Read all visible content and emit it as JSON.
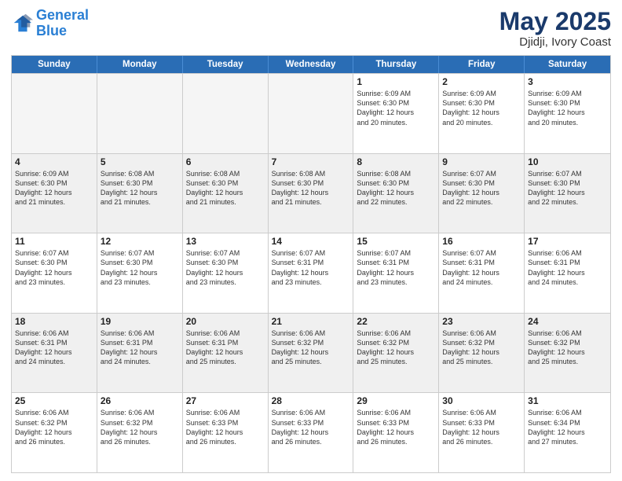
{
  "logo": {
    "line1": "General",
    "line2": "Blue"
  },
  "title": "May 2025",
  "subtitle": "Djidji, Ivory Coast",
  "header": {
    "days": [
      "Sunday",
      "Monday",
      "Tuesday",
      "Wednesday",
      "Thursday",
      "Friday",
      "Saturday"
    ]
  },
  "rows": [
    [
      {
        "day": "",
        "text": "",
        "empty": true
      },
      {
        "day": "",
        "text": "",
        "empty": true
      },
      {
        "day": "",
        "text": "",
        "empty": true
      },
      {
        "day": "",
        "text": "",
        "empty": true
      },
      {
        "day": "1",
        "text": "Sunrise: 6:09 AM\nSunset: 6:30 PM\nDaylight: 12 hours\nand 20 minutes."
      },
      {
        "day": "2",
        "text": "Sunrise: 6:09 AM\nSunset: 6:30 PM\nDaylight: 12 hours\nand 20 minutes."
      },
      {
        "day": "3",
        "text": "Sunrise: 6:09 AM\nSunset: 6:30 PM\nDaylight: 12 hours\nand 20 minutes."
      }
    ],
    [
      {
        "day": "4",
        "text": "Sunrise: 6:09 AM\nSunset: 6:30 PM\nDaylight: 12 hours\nand 21 minutes."
      },
      {
        "day": "5",
        "text": "Sunrise: 6:08 AM\nSunset: 6:30 PM\nDaylight: 12 hours\nand 21 minutes."
      },
      {
        "day": "6",
        "text": "Sunrise: 6:08 AM\nSunset: 6:30 PM\nDaylight: 12 hours\nand 21 minutes."
      },
      {
        "day": "7",
        "text": "Sunrise: 6:08 AM\nSunset: 6:30 PM\nDaylight: 12 hours\nand 21 minutes."
      },
      {
        "day": "8",
        "text": "Sunrise: 6:08 AM\nSunset: 6:30 PM\nDaylight: 12 hours\nand 22 minutes."
      },
      {
        "day": "9",
        "text": "Sunrise: 6:07 AM\nSunset: 6:30 PM\nDaylight: 12 hours\nand 22 minutes."
      },
      {
        "day": "10",
        "text": "Sunrise: 6:07 AM\nSunset: 6:30 PM\nDaylight: 12 hours\nand 22 minutes."
      }
    ],
    [
      {
        "day": "11",
        "text": "Sunrise: 6:07 AM\nSunset: 6:30 PM\nDaylight: 12 hours\nand 23 minutes."
      },
      {
        "day": "12",
        "text": "Sunrise: 6:07 AM\nSunset: 6:30 PM\nDaylight: 12 hours\nand 23 minutes."
      },
      {
        "day": "13",
        "text": "Sunrise: 6:07 AM\nSunset: 6:30 PM\nDaylight: 12 hours\nand 23 minutes."
      },
      {
        "day": "14",
        "text": "Sunrise: 6:07 AM\nSunset: 6:31 PM\nDaylight: 12 hours\nand 23 minutes."
      },
      {
        "day": "15",
        "text": "Sunrise: 6:07 AM\nSunset: 6:31 PM\nDaylight: 12 hours\nand 23 minutes."
      },
      {
        "day": "16",
        "text": "Sunrise: 6:07 AM\nSunset: 6:31 PM\nDaylight: 12 hours\nand 24 minutes."
      },
      {
        "day": "17",
        "text": "Sunrise: 6:06 AM\nSunset: 6:31 PM\nDaylight: 12 hours\nand 24 minutes."
      }
    ],
    [
      {
        "day": "18",
        "text": "Sunrise: 6:06 AM\nSunset: 6:31 PM\nDaylight: 12 hours\nand 24 minutes."
      },
      {
        "day": "19",
        "text": "Sunrise: 6:06 AM\nSunset: 6:31 PM\nDaylight: 12 hours\nand 24 minutes."
      },
      {
        "day": "20",
        "text": "Sunrise: 6:06 AM\nSunset: 6:31 PM\nDaylight: 12 hours\nand 25 minutes."
      },
      {
        "day": "21",
        "text": "Sunrise: 6:06 AM\nSunset: 6:32 PM\nDaylight: 12 hours\nand 25 minutes."
      },
      {
        "day": "22",
        "text": "Sunrise: 6:06 AM\nSunset: 6:32 PM\nDaylight: 12 hours\nand 25 minutes."
      },
      {
        "day": "23",
        "text": "Sunrise: 6:06 AM\nSunset: 6:32 PM\nDaylight: 12 hours\nand 25 minutes."
      },
      {
        "day": "24",
        "text": "Sunrise: 6:06 AM\nSunset: 6:32 PM\nDaylight: 12 hours\nand 25 minutes."
      }
    ],
    [
      {
        "day": "25",
        "text": "Sunrise: 6:06 AM\nSunset: 6:32 PM\nDaylight: 12 hours\nand 26 minutes."
      },
      {
        "day": "26",
        "text": "Sunrise: 6:06 AM\nSunset: 6:32 PM\nDaylight: 12 hours\nand 26 minutes."
      },
      {
        "day": "27",
        "text": "Sunrise: 6:06 AM\nSunset: 6:33 PM\nDaylight: 12 hours\nand 26 minutes."
      },
      {
        "day": "28",
        "text": "Sunrise: 6:06 AM\nSunset: 6:33 PM\nDaylight: 12 hours\nand 26 minutes."
      },
      {
        "day": "29",
        "text": "Sunrise: 6:06 AM\nSunset: 6:33 PM\nDaylight: 12 hours\nand 26 minutes."
      },
      {
        "day": "30",
        "text": "Sunrise: 6:06 AM\nSunset: 6:33 PM\nDaylight: 12 hours\nand 26 minutes."
      },
      {
        "day": "31",
        "text": "Sunrise: 6:06 AM\nSunset: 6:34 PM\nDaylight: 12 hours\nand 27 minutes."
      }
    ]
  ]
}
